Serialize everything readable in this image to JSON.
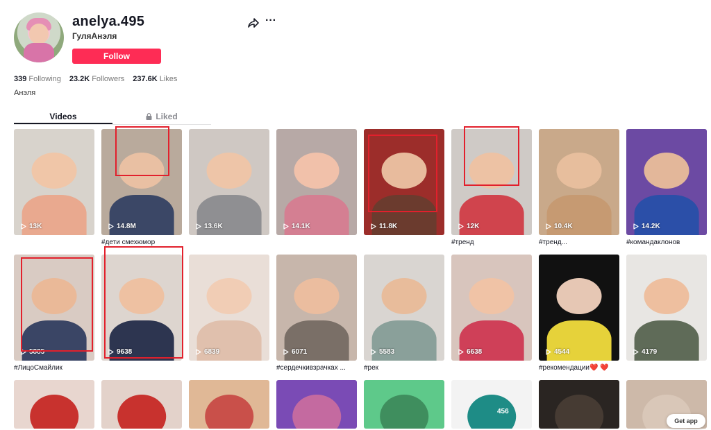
{
  "profile": {
    "username": "anelya.495",
    "nickname": "ГуляАнэля",
    "follow_label": "Follow",
    "bio": "Анэля"
  },
  "stats": {
    "following_count": "339",
    "following_label": "Following",
    "followers_count": "23.2K",
    "followers_label": "Followers",
    "likes_count": "237.6K",
    "likes_label": "Likes"
  },
  "tabs": [
    {
      "label": "Videos",
      "active": true
    },
    {
      "label": "Liked",
      "active": false,
      "icon": "lock-icon"
    }
  ],
  "videos": [
    {
      "views": "13K",
      "caption": "",
      "bg": "#d8d3cc",
      "fg": "#f0c6a8",
      "cloth": "#e9a98f"
    },
    {
      "views": "14.8M",
      "caption": "#дети смехюмор",
      "bg": "#b9aa9c",
      "fg": "#e9c0a3",
      "cloth": "#3b4766"
    },
    {
      "views": "13.6K",
      "caption": "",
      "bg": "#cfc8c3",
      "fg": "#eec5a8",
      "cloth": "#8f8f92"
    },
    {
      "views": "14.1K",
      "caption": "",
      "bg": "#b7a9a6",
      "fg": "#f1c1aa",
      "cloth": "#d47f92"
    },
    {
      "views": "11.8K",
      "caption": "",
      "bg": "#9c2d2a",
      "fg": "#e8bb9d",
      "cloth": "#6b3b2e"
    },
    {
      "views": "12K",
      "caption": "#тренд",
      "bg": "#cfcac6",
      "fg": "#edc2a4",
      "cloth": "#d0444d"
    },
    {
      "views": "10.4K",
      "caption": "#тренд...",
      "bg": "#c9a98a",
      "fg": "#e7be9d",
      "cloth": "#c69a72"
    },
    {
      "views": "14.2K",
      "caption": "#командаклонов",
      "bg": "#6c4aa3",
      "fg": "#e3b79a",
      "cloth": "#2b4fa8"
    },
    {
      "views": "5885",
      "caption": "#ЛицоСмайлик",
      "bg": "#d9cbc3",
      "fg": "#eab998",
      "cloth": "#3a4565"
    },
    {
      "views": "9638",
      "caption": "",
      "bg": "#ddd5cf",
      "fg": "#eec1a2",
      "cloth": "#2d3550"
    },
    {
      "views": "6839",
      "caption": "",
      "bg": "#e9ded7",
      "fg": "#f1cdb5",
      "cloth": "#e0c0ad"
    },
    {
      "views": "6071",
      "caption": "#сердечкивзрачках ...",
      "bg": "#c7b6ab",
      "fg": "#ebbd9f",
      "cloth": "#7a6f67"
    },
    {
      "views": "5583",
      "caption": "#рек",
      "bg": "#d9d5d1",
      "fg": "#e8bc9b",
      "cloth": "#8aa09a"
    },
    {
      "views": "6638",
      "caption": "",
      "bg": "#d8c5bd",
      "fg": "#f0c3a6",
      "cloth": "#cf4058"
    },
    {
      "views": "4544",
      "caption": "#рекомендации❤️ ❤️",
      "bg": "#111111",
      "fg": "#e6c7b4",
      "cloth": "#e6d23a"
    },
    {
      "views": "4179",
      "caption": "",
      "bg": "#e8e6e3",
      "fg": "#eebf9f",
      "cloth": "#5f6b58"
    }
  ],
  "row3": [
    {
      "bg": "#e8d6cf",
      "fg": "#c8322e"
    },
    {
      "bg": "#e3d2ca",
      "fg": "#c8322e"
    },
    {
      "bg": "#e0b896",
      "fg": "#c9504a"
    },
    {
      "bg": "#7a4bb5",
      "fg": "#c46aa0"
    },
    {
      "bg": "#5ec98a",
      "fg": "#3f8e5e"
    },
    {
      "bg": "#f3f3f3",
      "fg": "#1e8c86"
    },
    {
      "bg": "#2a2522",
      "fg": "#463b33"
    },
    {
      "bg": "#cdb9a9",
      "fg": "#d9c7b8"
    }
  ],
  "row3_overlay_text": "456",
  "get_app_label": "Get app",
  "colors": {
    "accent": "#fe2c55",
    "highlight_box": "#e2202c"
  }
}
